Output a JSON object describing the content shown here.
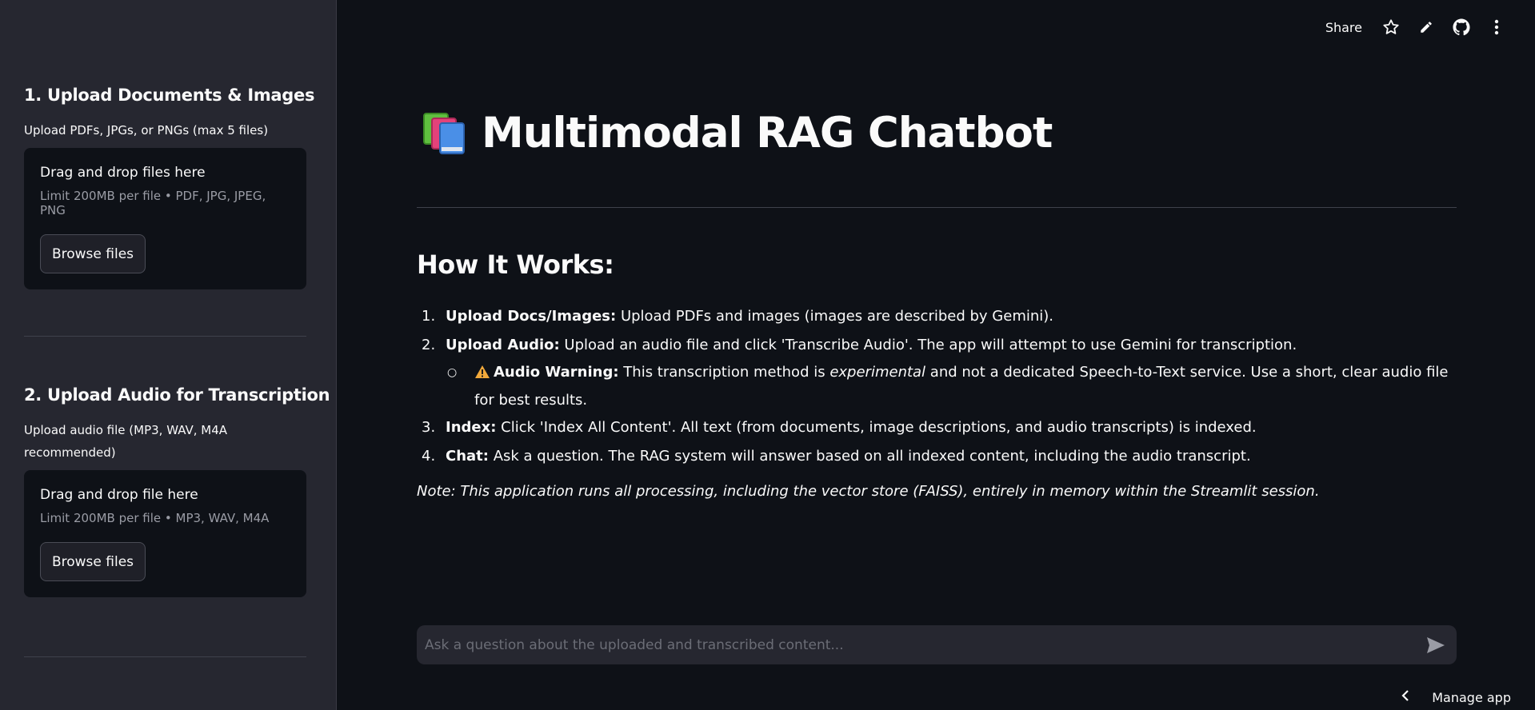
{
  "sidebar": {
    "sections": [
      {
        "title": "1. Upload Documents & Images",
        "label": "Upload PDFs, JPGs, or PNGs (max 5 files)",
        "drop_title": "Drag and drop files here",
        "limit": "Limit 200MB per file • PDF, JPG, JPEG, PNG",
        "button": "Browse files"
      },
      {
        "title": "2. Upload Audio for Transcription",
        "label_line1": "Upload audio file (MP3, WAV, M4A",
        "label_line2": "recommended)",
        "drop_title": "Drag and drop file here",
        "limit": "Limit 200MB per file • MP3, WAV, M4A",
        "button": "Browse files"
      }
    ]
  },
  "topbar": {
    "share": "Share",
    "icons": [
      "star-icon",
      "pencil-icon",
      "github-icon",
      "more-vertical-icon"
    ]
  },
  "main": {
    "title": "Multimodal RAG Chatbot",
    "title_icon": "books-emoji",
    "how_title": "How It Works:",
    "steps": [
      {
        "num": "1.",
        "bold": "Upload Docs/Images:",
        "text": " Upload PDFs and images (images are described by Gemini)."
      },
      {
        "num": "2.",
        "bold": "Upload Audio:",
        "text": " Upload an audio file and click 'Transcribe Audio'. The app will attempt to use Gemini for transcription."
      },
      {
        "num": "3.",
        "bold": "Index:",
        "text": " Click 'Index All Content'. All text (from documents, image descriptions, and audio transcripts) is indexed."
      },
      {
        "num": "4.",
        "bold": "Chat:",
        "text": " Ask a question. The RAG system will answer based on all indexed content, including the audio transcript."
      }
    ],
    "warning": {
      "icon": "warning-icon",
      "bold": "Audio Warning:",
      "text_before": " This transcription method is ",
      "italic": "experimental",
      "text_after": " and not a dedicated Speech-to-Text service. Use a short, clear audio file for best results."
    },
    "note": "Note: This application runs all processing, including the vector store (FAISS), entirely in memory within the Streamlit session."
  },
  "chat": {
    "placeholder": "Ask a question about the uploaded and transcribed content..."
  },
  "footer": {
    "manage": "Manage app"
  },
  "colors": {
    "background": "#0e1117",
    "sidebar": "#262730",
    "text": "#fafafa",
    "muted": "#9a9ca5"
  }
}
